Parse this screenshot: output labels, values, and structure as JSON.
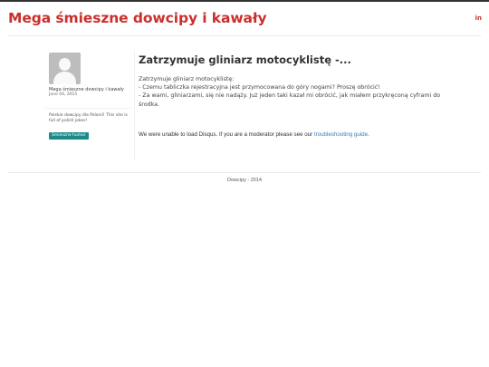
{
  "header": {
    "site_title": "Mega śmieszne dowcipy i kawały",
    "linkedin_label": "in"
  },
  "sidebar": {
    "author": "Mega śmieszne dowcipy i kawały",
    "date": "June 04, 2015",
    "description": "Polskie dowcipy dla Polonii! This site is full of polish jokes!",
    "tag": "Śmieszne humor"
  },
  "post": {
    "title": "Zatrzymuje gliniarz motocyklistę -...",
    "lines": [
      "Zatrzymuje gliniarz motocyklistę:",
      "- Czemu tabliczka rejestracyjna jest przymocowana do góry nogami? Proszę obrócić!",
      "- Za wami, gliniarzami, się nie nadąży. Już jeden taki kazał mi obrócić, jak miałem przykręconą cyframi do środka."
    ]
  },
  "disqus": {
    "message": "We were unable to load Disqus. If you are a moderator please see our ",
    "link_text": "troubleshooting guide",
    "suffix": "."
  },
  "footer": {
    "text": "Dowcipy - 2014"
  },
  "colors": {
    "brand": "#c9302c",
    "tag_bg": "#1d8a8a",
    "link": "#3a7cc0"
  }
}
